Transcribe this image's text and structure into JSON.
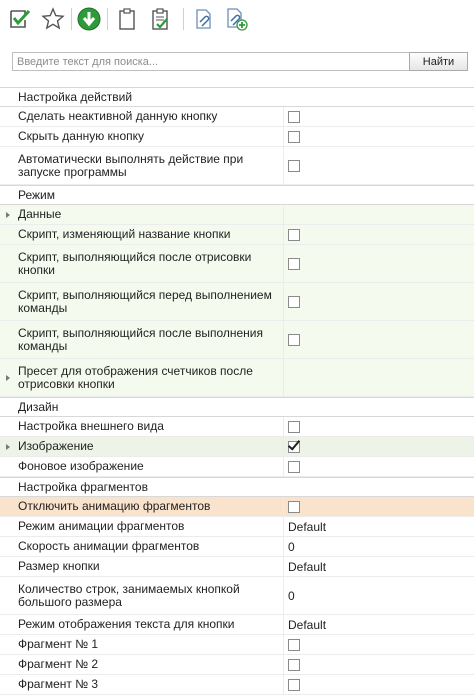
{
  "toolbar": {
    "icons": [
      "check-icon",
      "star-icon",
      "download-icon",
      "clipboard-icon",
      "clipboard-check-icon",
      "attachment-icon",
      "attachment-add-icon"
    ]
  },
  "search": {
    "placeholder": "Введите текст для поиска...",
    "value": "",
    "button_label": "Найти"
  },
  "categories": [
    {
      "title": "Настройка действий",
      "rows": [
        {
          "label": "Сделать неактивной данную кнопку",
          "type": "checkbox",
          "checked": false
        },
        {
          "label": "Скрыть данную кнопку",
          "type": "checkbox",
          "checked": false
        },
        {
          "label": "Автоматически выполнять действие при запуске программы",
          "type": "checkbox",
          "checked": false
        }
      ]
    },
    {
      "title": "Режим",
      "rows": [
        {
          "label": "Данные",
          "type": "expand",
          "value": ""
        },
        {
          "label": "Скрипт, изменяющий название кнопки",
          "type": "checkbox",
          "checked": false
        },
        {
          "label": "Скрипт, выполняющийся после отрисовки кнопки",
          "type": "checkbox",
          "checked": false
        },
        {
          "label": "Скрипт, выполняющийся перед выполнением команды",
          "type": "checkbox",
          "checked": false
        },
        {
          "label": "Скрипт, выполняющийся после выполнения команды",
          "type": "checkbox",
          "checked": false
        },
        {
          "label": "Пресет для отображения счетчиков после отрисовки кнопки",
          "type": "expand",
          "value": ""
        }
      ]
    },
    {
      "title": "Дизайн",
      "rows": [
        {
          "label": "Настройка внешнего вида",
          "type": "checkbox",
          "checked": false
        },
        {
          "label": "Изображение",
          "type": "checkbox",
          "checked": true
        },
        {
          "label": "Фоновое изображение",
          "type": "checkbox",
          "checked": false
        }
      ]
    },
    {
      "title": "Настройка фрагментов",
      "rows": [
        {
          "label": "Отключить анимацию фрагментов",
          "type": "checkbox",
          "checked": false
        },
        {
          "label": "Режим анимации фрагментов",
          "type": "text",
          "value": "Default"
        },
        {
          "label": "Скорость анимации фрагментов",
          "type": "text",
          "value": "0"
        },
        {
          "label": "Размер кнопки",
          "type": "text",
          "value": "Default"
        },
        {
          "label": "Количество строк, занимаемых кнопкой большого размера",
          "type": "text",
          "value": "0"
        },
        {
          "label": "Режим отображения текста для кнопки",
          "type": "text",
          "value": "Default"
        },
        {
          "label": "Фрагмент № 1",
          "type": "checkbox",
          "checked": false
        },
        {
          "label": "Фрагмент № 2",
          "type": "checkbox",
          "checked": false
        },
        {
          "label": "Фрагмент № 3",
          "type": "checkbox",
          "checked": false
        }
      ]
    }
  ],
  "colors": {
    "highlight_row": "#fae3cc",
    "accent_green": "#2e9b3a"
  }
}
